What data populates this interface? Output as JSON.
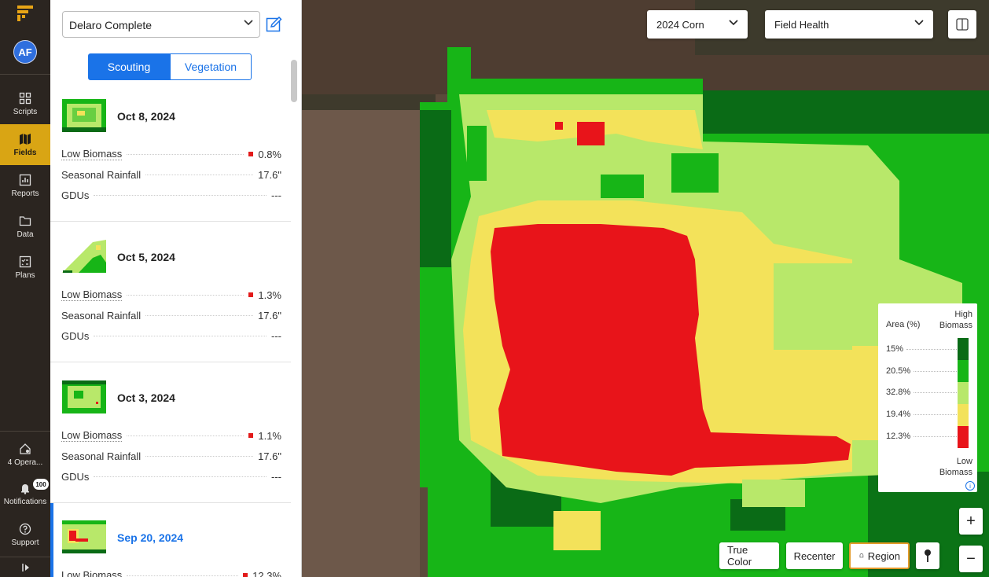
{
  "nav": {
    "avatar": "AF",
    "items": [
      {
        "label": "Scripts",
        "icon": "grid-icon"
      },
      {
        "label": "Fields",
        "icon": "map-icon"
      },
      {
        "label": "Reports",
        "icon": "chart-icon"
      },
      {
        "label": "Data",
        "icon": "folder-icon"
      },
      {
        "label": "Plans",
        "icon": "checklist-icon"
      }
    ],
    "bottom": [
      {
        "label": "4 Opera...",
        "icon": "home-icon"
      },
      {
        "label": "Notifications",
        "icon": "bell-icon",
        "badge": "100"
      },
      {
        "label": "Support",
        "icon": "help-icon"
      }
    ],
    "accent": "#d9a514"
  },
  "panel": {
    "operation": "Delaro Complete",
    "tabs": [
      "Scouting",
      "Vegetation"
    ],
    "cards": [
      {
        "date": "Oct 8, 2024",
        "rows": [
          {
            "label": "Low Biomass",
            "value": "0.8%"
          },
          {
            "label": "Seasonal Rainfall",
            "value": "17.6\""
          },
          {
            "label": "GDUs",
            "value": "---"
          }
        ]
      },
      {
        "date": "Oct 5, 2024",
        "rows": [
          {
            "label": "Low Biomass",
            "value": "1.3%"
          },
          {
            "label": "Seasonal Rainfall",
            "value": "17.6\""
          },
          {
            "label": "GDUs",
            "value": "---"
          }
        ]
      },
      {
        "date": "Oct 3, 2024",
        "rows": [
          {
            "label": "Low Biomass",
            "value": "1.1%"
          },
          {
            "label": "Seasonal Rainfall",
            "value": "17.6\""
          },
          {
            "label": "GDUs",
            "value": "---"
          }
        ]
      },
      {
        "date": "Sep 20, 2024",
        "rows": [
          {
            "label": "Low Biomass",
            "value": "12.3%"
          }
        ]
      }
    ]
  },
  "map": {
    "season": "2024 Corn",
    "layer": "Field Health",
    "buttons": {
      "true_color": "True Color",
      "recenter": "Recenter",
      "region": "Region"
    },
    "zoom_in": "+",
    "zoom_out": "−"
  },
  "legend": {
    "area_header": "Area (%)",
    "high_1": "High",
    "high_2": "Biomass",
    "low_1": "Low",
    "low_2": "Biomass",
    "entries": [
      {
        "pct": "15%",
        "color": "#0a6b16"
      },
      {
        "pct": "20.5%",
        "color": "#17b517"
      },
      {
        "pct": "32.8%",
        "color": "#b8e86a"
      },
      {
        "pct": "19.4%",
        "color": "#f3e25a"
      },
      {
        "pct": "12.3%",
        "color": "#e8141a"
      }
    ]
  }
}
